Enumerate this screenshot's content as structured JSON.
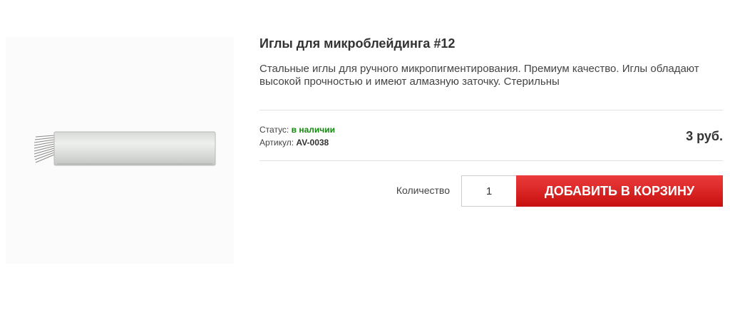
{
  "product": {
    "title": "Иглы для микроблейдинга #12",
    "description": "Стальные иглы для ручного микропигментирования. Премиум качество. Иглы обладают высокой прочностью и имеют алмазную заточку. Стерильны",
    "status_label": "Статус:",
    "status_value": "в наличии",
    "sku_label": "Артикул:",
    "sku_value": "AV-0038",
    "price": "3 руб.",
    "image_icon": "microblading-needle-image"
  },
  "cart": {
    "quantity_label": "Количество",
    "quantity_value": "1",
    "add_button_label": "ДОБАВИТЬ В КОРЗИНУ"
  },
  "colors": {
    "status_green": "#138a0e",
    "button_red": "#d81f1f"
  }
}
